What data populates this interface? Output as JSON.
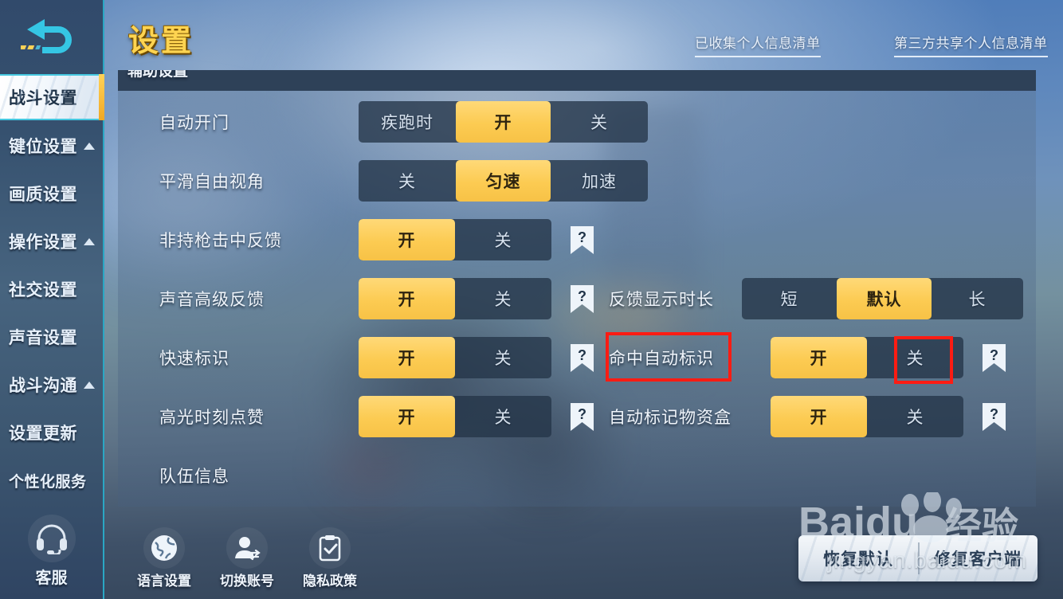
{
  "sidebar": {
    "back_icon": "back-arrow-icon",
    "items": [
      {
        "label": "战斗设置",
        "active": true,
        "caret": false
      },
      {
        "label": "键位设置",
        "active": false,
        "caret": true
      },
      {
        "label": "画质设置",
        "active": false,
        "caret": false
      },
      {
        "label": "操作设置",
        "active": false,
        "caret": true
      },
      {
        "label": "社交设置",
        "active": false,
        "caret": false
      },
      {
        "label": "声音设置",
        "active": false,
        "caret": false
      },
      {
        "label": "战斗沟通",
        "active": false,
        "caret": true
      },
      {
        "label": "设置更新",
        "active": false,
        "caret": false
      },
      {
        "label": "个性化服务",
        "active": false,
        "caret": false
      }
    ],
    "service": {
      "label": "客服",
      "icon": "headset-icon"
    }
  },
  "header": {
    "title": "设置",
    "links": [
      {
        "label": "已收集个人信息清单"
      },
      {
        "label": "第三方共享个人信息清单"
      }
    ]
  },
  "panel": {
    "section_title": "辅助设置",
    "left_rows": [
      {
        "label": "自动开门",
        "options": [
          "疾跑时",
          "开",
          "关"
        ],
        "selected": 1,
        "help": false
      },
      {
        "label": "平滑自由视角",
        "options": [
          "关",
          "匀速",
          "加速"
        ],
        "selected": 1,
        "help": false
      },
      {
        "label": "非持枪击中反馈",
        "options": [
          "开",
          "关"
        ],
        "selected": 0,
        "help": true
      },
      {
        "label": "声音高级反馈",
        "options": [
          "开",
          "关"
        ],
        "selected": 0,
        "help": true
      },
      {
        "label": "快速标识",
        "options": [
          "开",
          "关"
        ],
        "selected": 0,
        "help": true
      },
      {
        "label": "高光时刻点赞",
        "options": [
          "开",
          "关"
        ],
        "selected": 0,
        "help": true
      },
      {
        "label": "队伍信息",
        "options": [],
        "selected": -1,
        "help": false
      }
    ],
    "right_rows": [
      {
        "label": "反馈显示时长",
        "options": [
          "短",
          "默认",
          "长"
        ],
        "selected": 1,
        "help": false
      },
      {
        "label": "命中自动标识",
        "options": [
          "开",
          "关"
        ],
        "selected": 0,
        "help": true
      },
      {
        "label": "自动标记物资盒",
        "options": [
          "开",
          "关"
        ],
        "selected": 0,
        "help": true
      }
    ]
  },
  "bottom": {
    "icons": [
      {
        "label": "语言设置",
        "icon": "globe-icon"
      },
      {
        "label": "切换账号",
        "icon": "switch-account-icon"
      },
      {
        "label": "隐私政策",
        "icon": "clipboard-check-icon"
      }
    ],
    "actions": [
      {
        "label": "恢复默认"
      },
      {
        "label": "修复客户端"
      }
    ]
  },
  "watermark": {
    "brand": "Baidu",
    "suffix": "经验",
    "url": "jingyan.baidu.com"
  },
  "colors": {
    "accent_yellow": "#fccb52",
    "title_yellow": "#ffd451",
    "highlight_red": "#fd1c13",
    "cyan_border": "#2aa7c4",
    "panel_dark": "#2e4158"
  }
}
